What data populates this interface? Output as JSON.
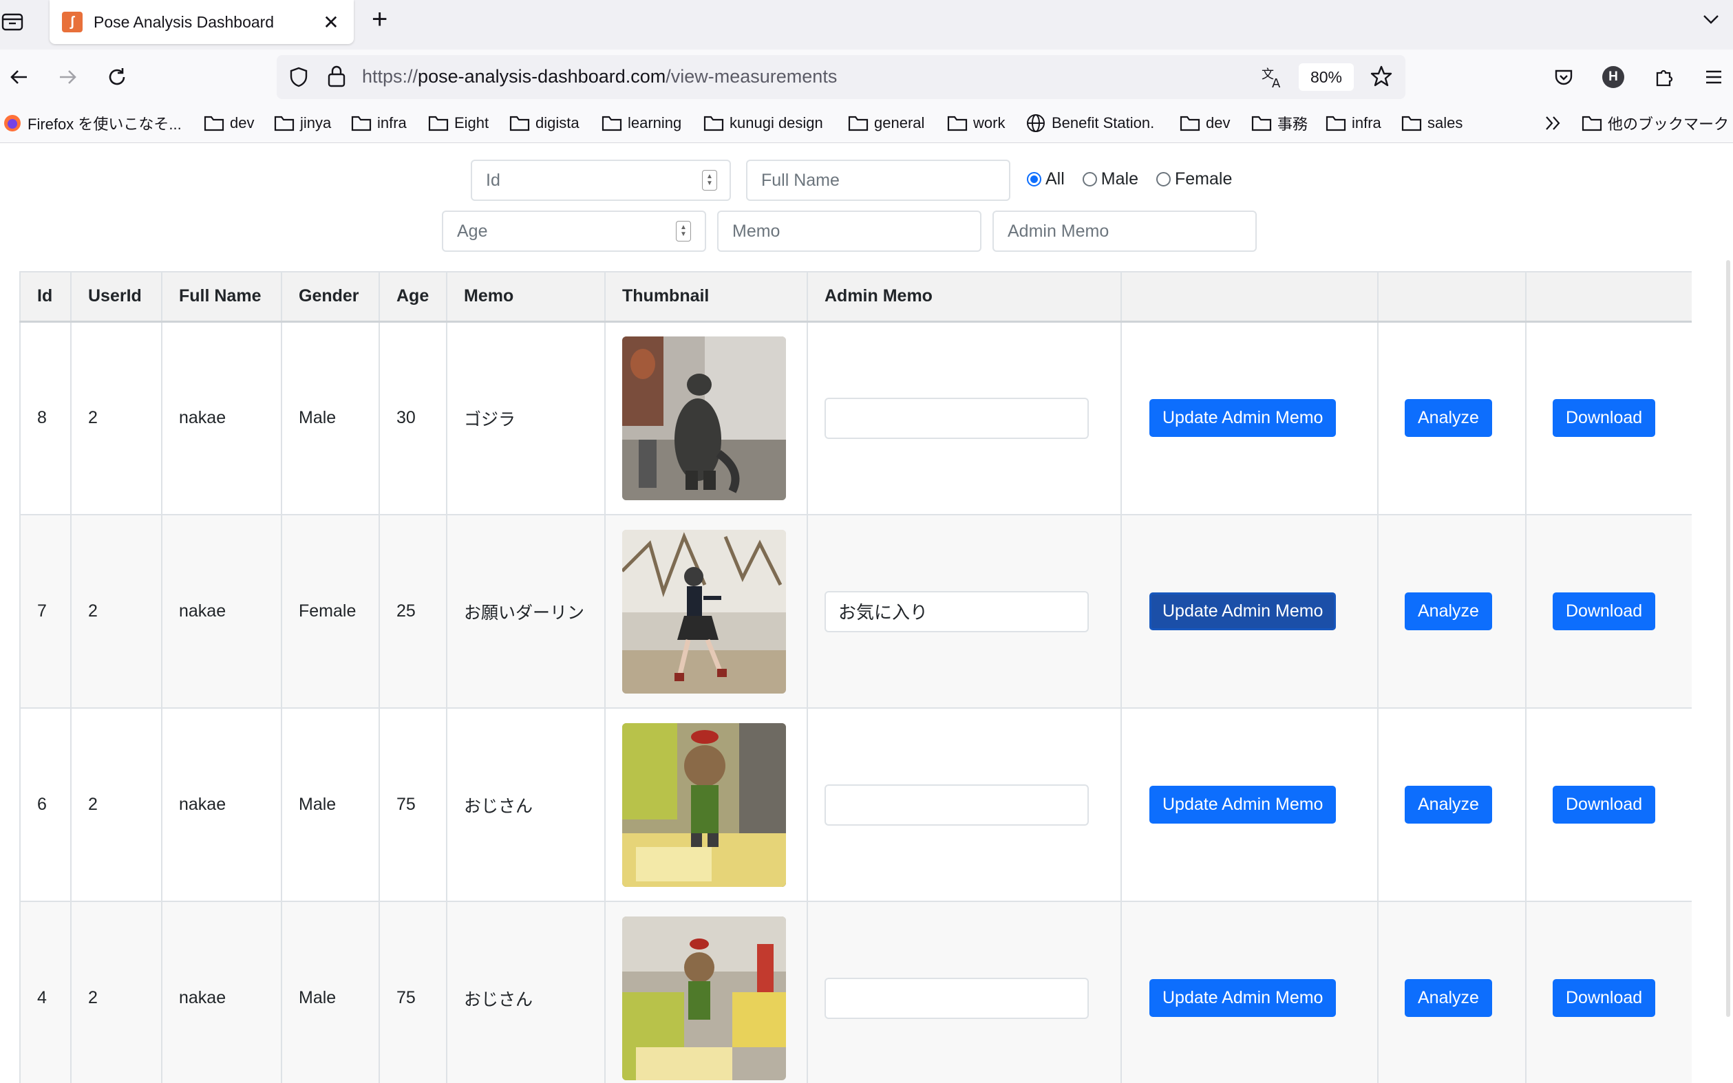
{
  "browser": {
    "tab": {
      "title": "Pose Analysis Dashboard"
    },
    "url": {
      "scheme": "https://",
      "domain": "pose-analysis-dashboard.com",
      "path": "/view-measurements"
    },
    "zoom": "80%",
    "profile_initial": "H",
    "bookmarks": [
      {
        "label": "Firefox を使いこなそ...",
        "icon": "firefox-icon"
      },
      {
        "label": "dev",
        "icon": "folder-icon"
      },
      {
        "label": "jinya",
        "icon": "folder-icon"
      },
      {
        "label": "infra",
        "icon": "folder-icon"
      },
      {
        "label": "Eight",
        "icon": "folder-icon"
      },
      {
        "label": "digista",
        "icon": "folder-icon"
      },
      {
        "label": "learning",
        "icon": "folder-icon"
      },
      {
        "label": "kunugi design",
        "icon": "folder-icon"
      },
      {
        "label": "general",
        "icon": "folder-icon"
      },
      {
        "label": "work",
        "icon": "folder-icon"
      },
      {
        "label": "Benefit Station.",
        "icon": "globe-icon"
      },
      {
        "label": "dev",
        "icon": "folder-icon"
      },
      {
        "label": "事務",
        "icon": "folder-icon"
      },
      {
        "label": "infra",
        "icon": "folder-icon"
      },
      {
        "label": "sales",
        "icon": "folder-icon"
      }
    ],
    "other_bookmarks": "他のブックマーク"
  },
  "filters": {
    "id_placeholder": "Id",
    "fullname_placeholder": "Full Name",
    "age_placeholder": "Age",
    "memo_placeholder": "Memo",
    "admin_memo_placeholder": "Admin Memo",
    "gender_options": [
      {
        "label": "All",
        "checked": true
      },
      {
        "label": "Male",
        "checked": false
      },
      {
        "label": "Female",
        "checked": false
      }
    ]
  },
  "table": {
    "headers": [
      "Id",
      "UserId",
      "Full Name",
      "Gender",
      "Age",
      "Memo",
      "Thumbnail",
      "Admin Memo",
      "",
      "",
      ""
    ],
    "rows": [
      {
        "id": "8",
        "user_id": "2",
        "full_name": "nakae",
        "gender": "Male",
        "age": "30",
        "memo": "ゴジラ",
        "thumbnail": "godzilla-figure",
        "admin_memo": ""
      },
      {
        "id": "7",
        "user_id": "2",
        "full_name": "nakae",
        "gender": "Female",
        "age": "25",
        "memo": "お願いダーリン",
        "thumbnail": "dancer-in-park",
        "admin_memo": "お気に入り"
      },
      {
        "id": "6",
        "user_id": "2",
        "full_name": "nakae",
        "gender": "Male",
        "age": "75",
        "memo": "おじさん",
        "thumbnail": "old-man-figurine",
        "admin_memo": ""
      },
      {
        "id": "4",
        "user_id": "2",
        "full_name": "nakae",
        "gender": "Male",
        "age": "75",
        "memo": "おじさん",
        "thumbnail": "old-man-figurine-2",
        "admin_memo": ""
      }
    ],
    "buttons": {
      "update": "Update Admin Memo",
      "analyze": "Analyze",
      "download": "Download"
    }
  },
  "colors": {
    "primary": "#0d6efd",
    "primary_active": "#1b4fa8",
    "header_bg": "#f2f2f2",
    "border": "#dee2e6"
  }
}
